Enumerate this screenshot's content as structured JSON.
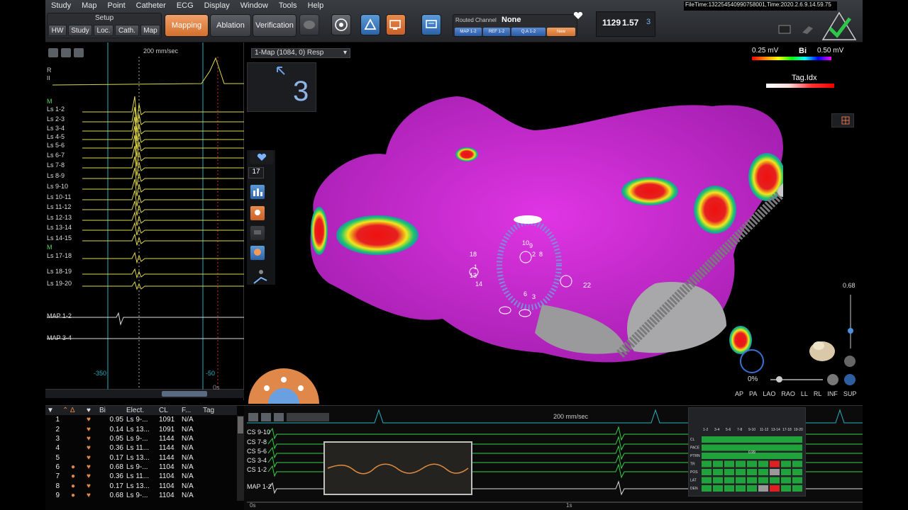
{
  "menu": [
    "Study",
    "Map",
    "Point",
    "Catheter",
    "ECG",
    "Display",
    "Window",
    "Tools",
    "Help"
  ],
  "setup": {
    "label": "Setup",
    "buttons": [
      "HW",
      "Study",
      "Loc.",
      "Cath.",
      "Map"
    ]
  },
  "workflow": {
    "mapping": "Mapping",
    "ablation": "Ablation",
    "verification": "Verification"
  },
  "routed": {
    "label": "Routed Channel",
    "value": "None",
    "tabs": [
      "MAP 1-2",
      "REF 1-2",
      "Q.A 1-2",
      "New"
    ]
  },
  "readouts": {
    "a": "1129",
    "b": "1.57",
    "count": "3"
  },
  "status_file": "FileTime:132254540990758001,Time:2020.2.6.9.14.59.75",
  "left": {
    "sweep": "200 mm/sec",
    "header_letters": [
      "R",
      "II",
      "M"
    ],
    "traces": [
      "Ls 1-2",
      "Ls 2-3",
      "Ls 3-4",
      "Ls 4-5",
      "Ls 5-6",
      "Ls 6-7",
      "Ls 7-8",
      "Ls 8-9",
      "Ls 9-10",
      "Ls 10-11",
      "Ls 11-12",
      "Ls 12-13",
      "Ls 13-14",
      "Ls 14-15",
      "Ls 17-18",
      "Ls 18-19",
      "Ls 19-20"
    ],
    "mid_marker": "M",
    "maps": [
      "MAP 1-2",
      "MAP 3-4"
    ],
    "axis": {
      "left": "-350",
      "right": "-50",
      "unit": "0s"
    }
  },
  "map": {
    "selector": "1-Map (1084, 0) Resp",
    "count": "3",
    "points_count": "17",
    "scale": {
      "low": "0.25 mV",
      "mode": "Bi",
      "high": "0.50 mV"
    },
    "tag": "Tag.Idx",
    "opacity": "0%",
    "slider_value": "0.68",
    "views": [
      "AP",
      "PA",
      "LAO",
      "RAO",
      "LL",
      "RL",
      "INF",
      "SUP"
    ],
    "label_22": "22",
    "catheter_labels": [
      "10",
      "9",
      "8",
      "2",
      "1",
      "13",
      "14",
      "18",
      "6",
      "3"
    ]
  },
  "points_table": {
    "headers": [
      "Bi",
      "Elect.",
      "CL",
      "F...",
      "Tag"
    ],
    "rows": [
      {
        "n": "1",
        "bi": "0.95",
        "el": "Ls 9-...",
        "cl": "1091",
        "f": "N/A"
      },
      {
        "n": "2",
        "bi": "0.14",
        "el": "Ls 13...",
        "cl": "1091",
        "f": "N/A"
      },
      {
        "n": "3",
        "bi": "0.95",
        "el": "Ls 9-...",
        "cl": "1144",
        "f": "N/A"
      },
      {
        "n": "4",
        "bi": "0.36",
        "el": "Ls 11...",
        "cl": "1144",
        "f": "N/A"
      },
      {
        "n": "5",
        "bi": "0.17",
        "el": "Ls 13...",
        "cl": "1144",
        "f": "N/A"
      },
      {
        "n": "6",
        "bi": "0.68",
        "el": "Ls 9-...",
        "cl": "1104",
        "f": "N/A"
      },
      {
        "n": "7",
        "bi": "0.36",
        "el": "Ls 11...",
        "cl": "1104",
        "f": "N/A"
      },
      {
        "n": "8",
        "bi": "0.17",
        "el": "Ls 13...",
        "cl": "1104",
        "f": "N/A"
      },
      {
        "n": "9",
        "bi": "0.68",
        "el": "Ls 9-...",
        "cl": "1104",
        "f": "N/A"
      }
    ]
  },
  "bottom_ecg": {
    "sweep": "200 mm/sec",
    "channels": [
      "CS 9-10",
      "CS 7-8",
      "CS 5-6",
      "CS 3-4",
      "CS 1-2",
      "MAP 1-2"
    ],
    "axis": {
      "start": "0s",
      "mid": "1s"
    },
    "grid_cols": [
      "1-2",
      "3-4",
      "5-6",
      "7-8",
      "9-10",
      "11-12",
      "13-14",
      "17-18",
      "19-20"
    ],
    "grid_rows": [
      "CL",
      "PACE",
      "PTRN",
      "TR",
      "POS",
      "LAT",
      "DEN"
    ],
    "grid_value": "0.99"
  }
}
